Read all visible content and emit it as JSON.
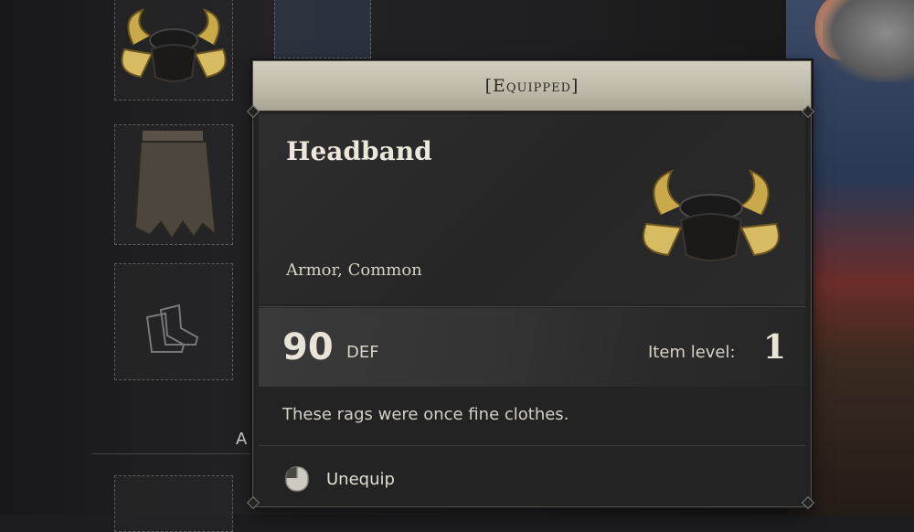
{
  "tooltip": {
    "status": "[Equipped]",
    "item_name": "Headband",
    "item_type": "Armor, Common",
    "def_value": "90",
    "def_label": "DEF",
    "item_level_label": "Item level:",
    "item_level_value": "1",
    "description": "These rags were once fine clothes.",
    "action_label": "Unequip",
    "action_icon": "mouse-left-click-icon"
  },
  "inventory": {
    "edge_letter": "A"
  },
  "colors": {
    "header_bg": "#c8c2b3",
    "panel_bg": "#232323",
    "text_light": "#ece7da",
    "gold": "#c9a94a"
  }
}
